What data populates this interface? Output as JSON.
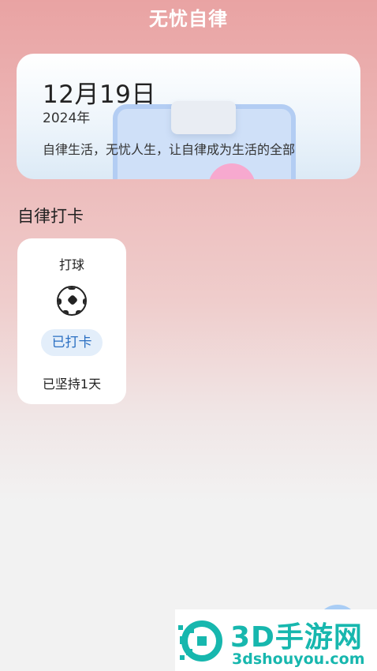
{
  "header": {
    "title": "无忧自律"
  },
  "hero": {
    "date": "12月19日",
    "year": "2024年",
    "slogan": "自律生活，无忧人生，让自律成为生活的全部"
  },
  "section": {
    "title": "自律打卡"
  },
  "habit_card": {
    "name": "打球",
    "icon": "soccer-ball-icon",
    "status": "已打卡",
    "streak": "已坚持1天"
  },
  "watermark": {
    "main": "3D手游网",
    "sub": "3dshouyou.com"
  },
  "colors": {
    "accent": "#2a6fc2",
    "badge_bg": "#e3eefa",
    "header_top": "#e9a3a3",
    "watermark": "#17b7ae"
  }
}
